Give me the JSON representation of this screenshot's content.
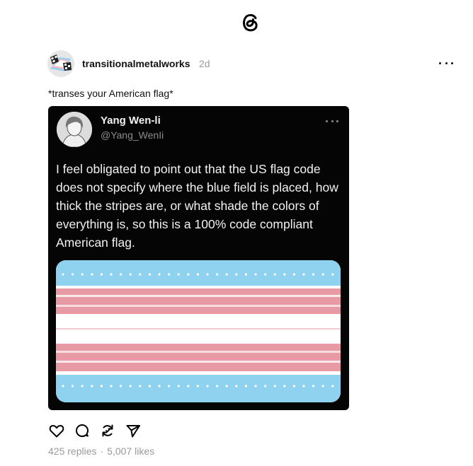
{
  "app": {
    "logo_icon": "threads-logo-icon"
  },
  "post": {
    "username": "transitionalmetalworks",
    "time": "2d",
    "caption": "*transes your American flag*",
    "more_icon": "more-horizontal-icon"
  },
  "embedded_tweet": {
    "name": "Yang Wen-li",
    "handle": "@Yang_WenIi",
    "text": "I feel obligated to point out that the US flag code does not specify where the blue field is placed, how thick the stripes are, or what shade the colors of everything is, so this is a 100% code compliant American flag.",
    "flag_colors": {
      "blue": "#8fd2f0",
      "pink": "#e89aa4",
      "white": "#ffffff"
    }
  },
  "actions": [
    {
      "name": "like",
      "icon": "heart-icon"
    },
    {
      "name": "reply",
      "icon": "comment-icon"
    },
    {
      "name": "repost",
      "icon": "repost-icon"
    },
    {
      "name": "share",
      "icon": "send-icon"
    }
  ],
  "stats": {
    "replies": "425 replies",
    "separator": "·",
    "likes": "5,007 likes"
  }
}
